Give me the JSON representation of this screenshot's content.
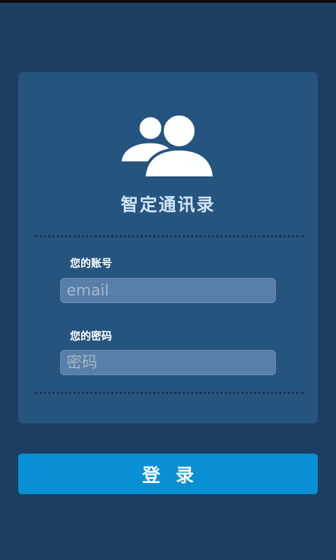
{
  "app": {
    "title": "智定通讯录",
    "logo_icon": "users-group-icon"
  },
  "login_form": {
    "account_label": "您的账号",
    "account_placeholder": "email",
    "account_value": "",
    "password_label": "您的密码",
    "password_placeholder": "密码",
    "password_value": ""
  },
  "actions": {
    "login_label": "登录"
  },
  "colors": {
    "background": "#1b3e61",
    "card": "#25547f",
    "input_fill": "#587fa9",
    "title_text": "#cfe5f8",
    "button": "#088fd4"
  }
}
